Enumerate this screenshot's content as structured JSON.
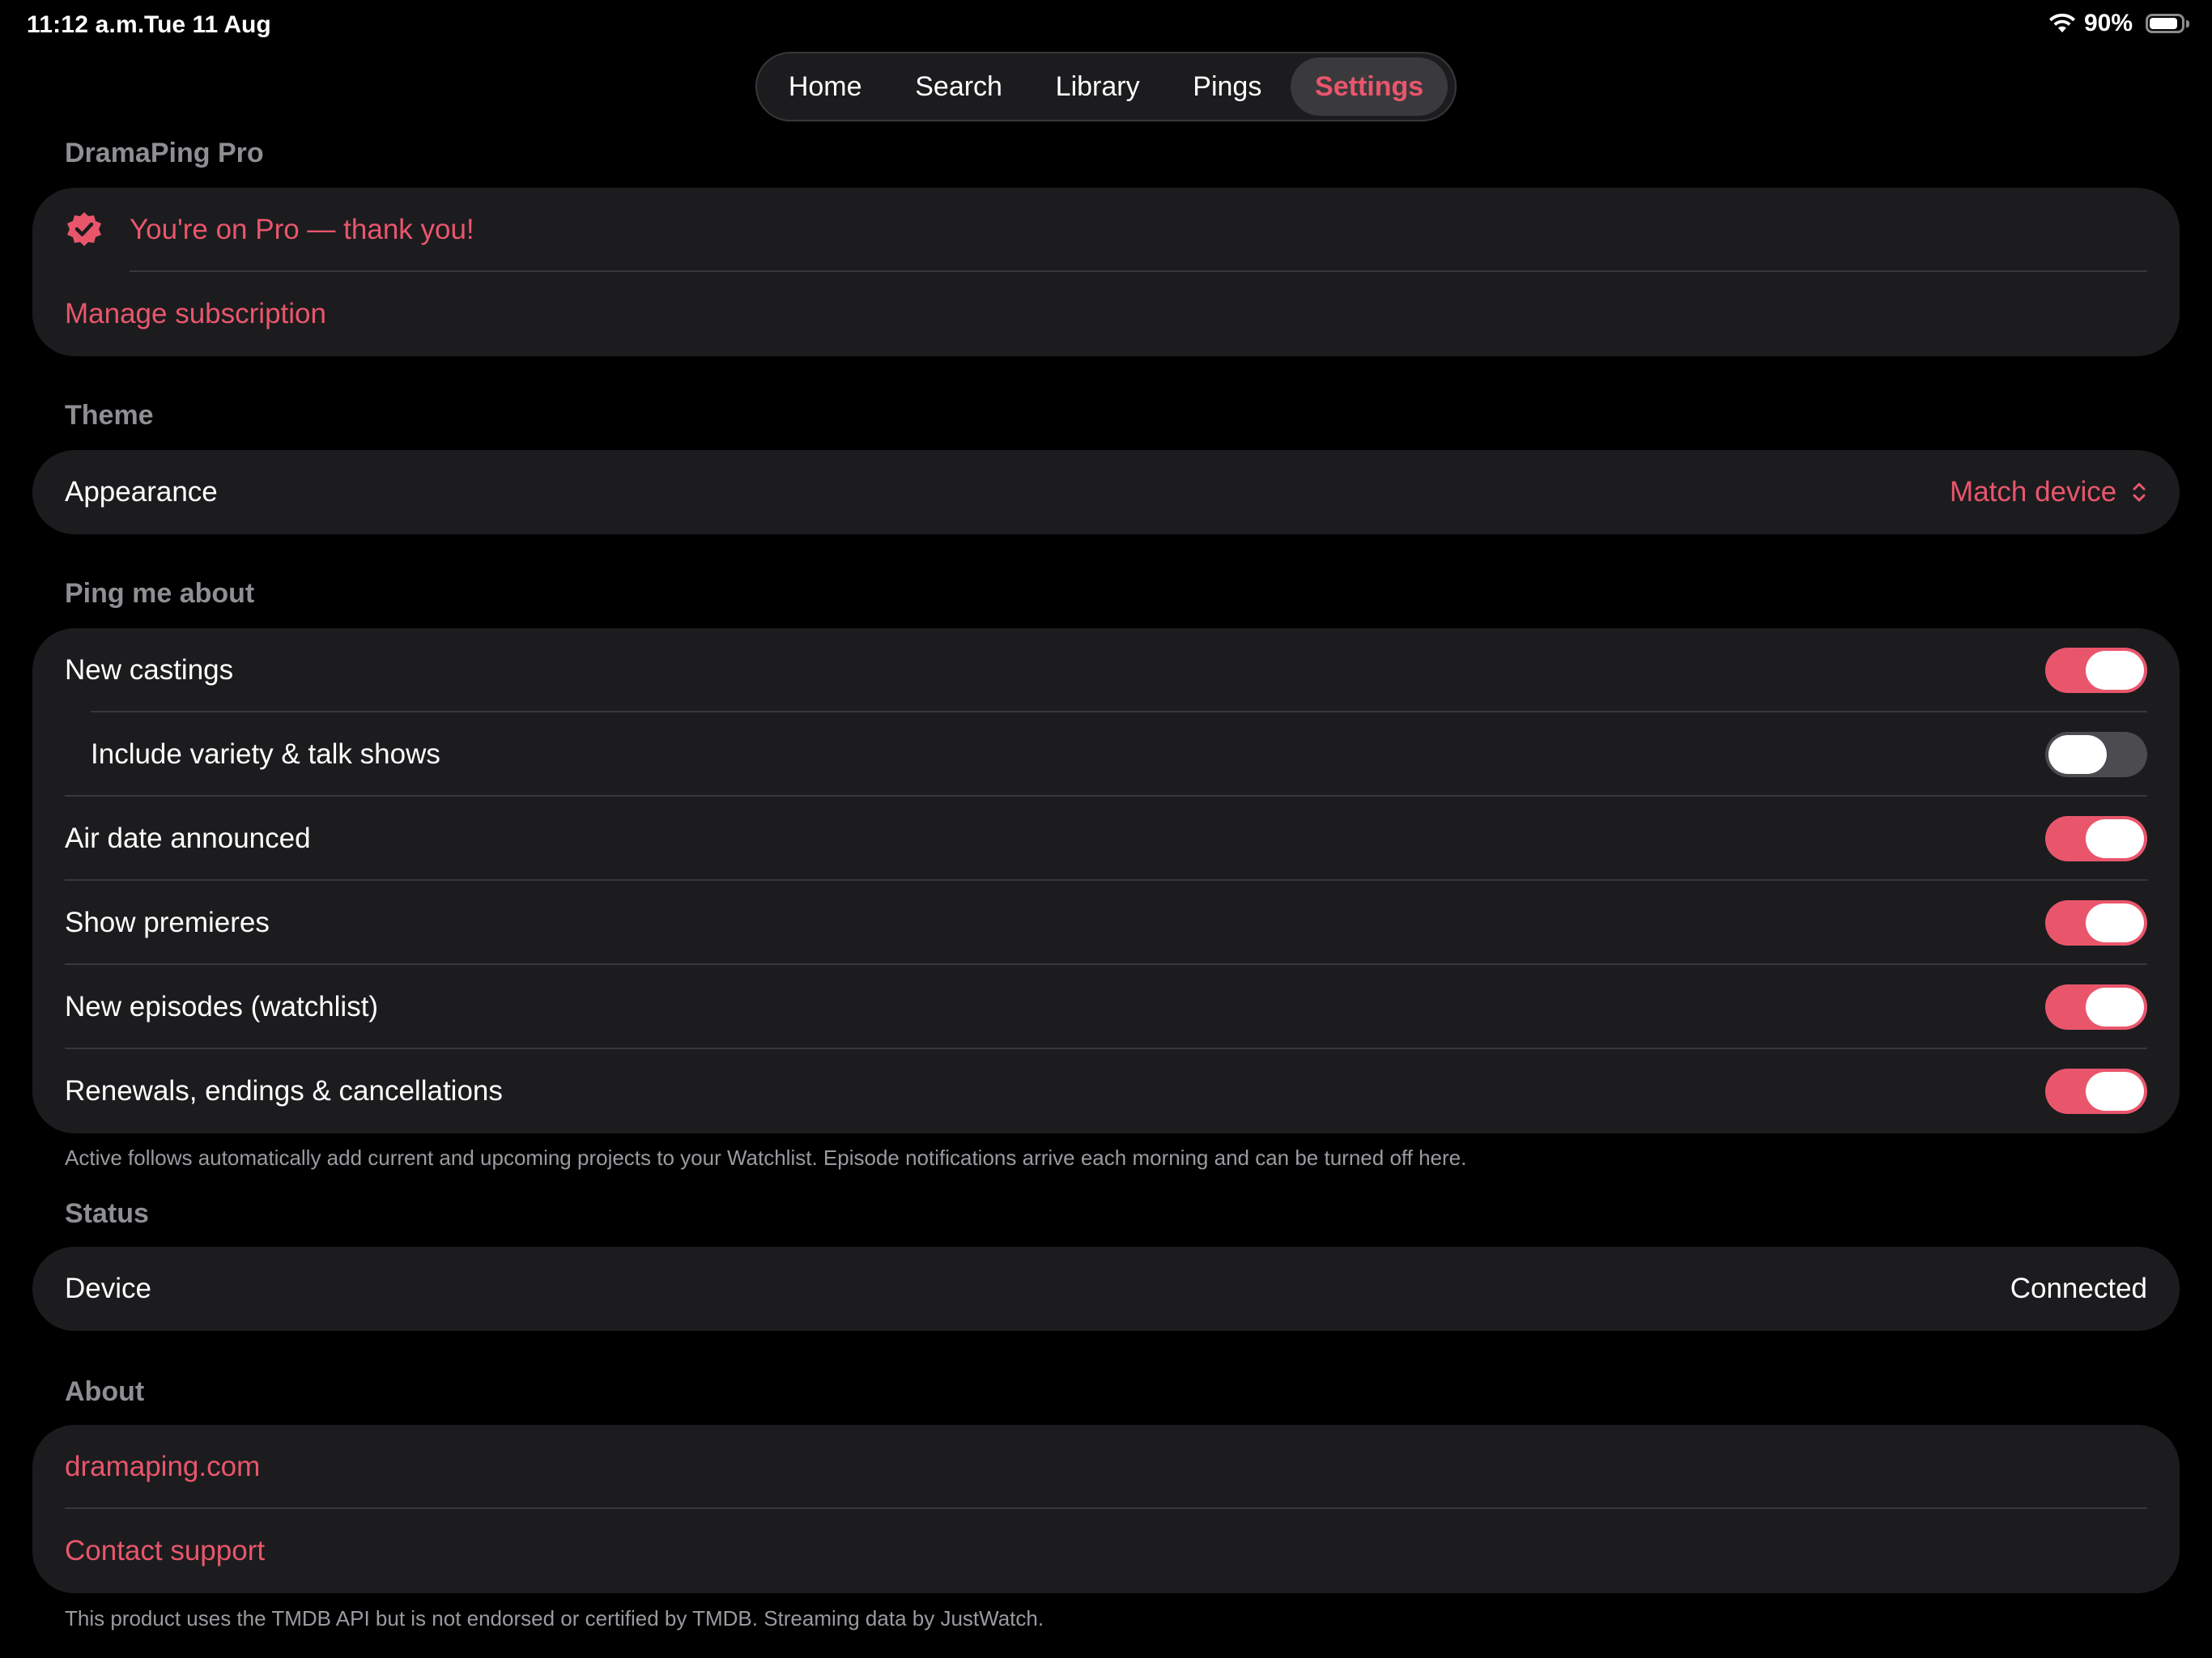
{
  "status_bar": {
    "time": "11:12 a.m.",
    "date": "Tue 11 Aug",
    "battery": "90%"
  },
  "tabs": [
    {
      "label": "Home"
    },
    {
      "label": "Search"
    },
    {
      "label": "Library"
    },
    {
      "label": "Pings"
    },
    {
      "label": "Settings"
    }
  ],
  "active_tab": "Settings",
  "pro": {
    "header": "DramaPing Pro",
    "status": "You're on Pro — thank you!",
    "manage": "Manage subscription"
  },
  "theme": {
    "header": "Theme",
    "appearance_label": "Appearance",
    "appearance_value": "Match device"
  },
  "ping": {
    "header": "Ping me about",
    "items": [
      {
        "label": "New castings",
        "on": true
      },
      {
        "label": "Include variety & talk shows",
        "on": false
      },
      {
        "label": "Air date announced",
        "on": true
      },
      {
        "label": "Show premieres",
        "on": true
      },
      {
        "label": "New episodes (watchlist)",
        "on": true
      },
      {
        "label": "Renewals, endings & cancellations",
        "on": true
      }
    ],
    "footnote": "Active follows automatically add current and upcoming projects to your Watchlist. Episode notifications arrive each morning and can be turned off here."
  },
  "status": {
    "header": "Status",
    "device_label": "Device",
    "device_value": "Connected"
  },
  "about": {
    "header": "About",
    "website": "dramaping.com",
    "support": "Contact support",
    "footnote": "This product uses the TMDB API but is not endorsed or certified by TMDB. Streaming data by JustWatch."
  },
  "colors": {
    "accent": "#e9566c",
    "background": "#000000",
    "card": "#1c1c1e",
    "toggle_off": "#4b4b50"
  }
}
